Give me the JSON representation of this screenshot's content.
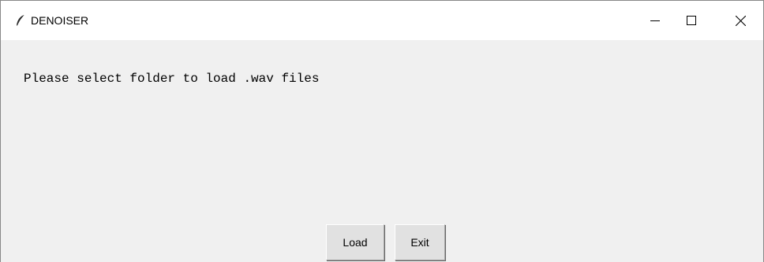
{
  "window": {
    "title": "DENOISER",
    "icon": "feather-icon",
    "controls": [
      "minimize-icon",
      "maximize-icon",
      "close-icon"
    ]
  },
  "main": {
    "message": "Please select folder to load .wav files",
    "buttons": {
      "load_label": "Load",
      "exit_label": "Exit"
    }
  },
  "colors": {
    "background": "#f0f0f0",
    "titlebar": "#ffffff",
    "button_face": "#e1e1e1"
  }
}
